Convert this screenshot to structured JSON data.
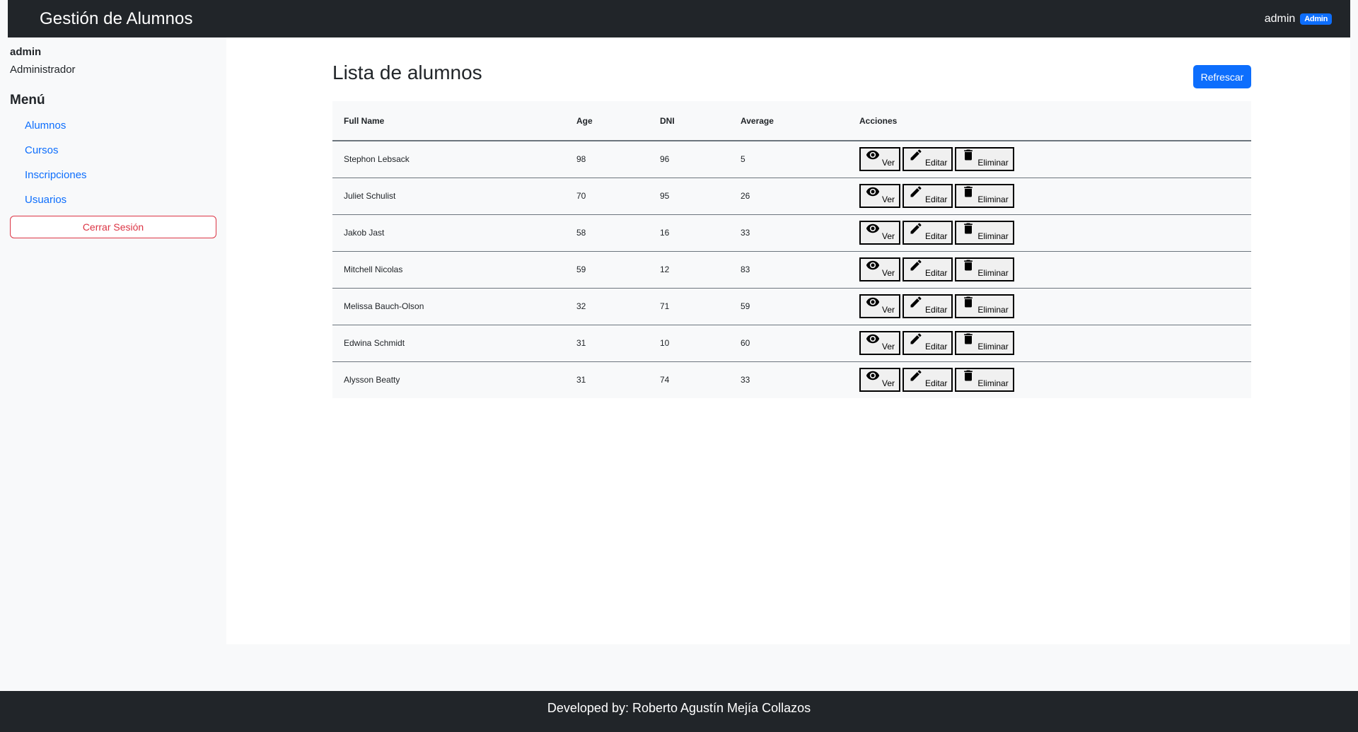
{
  "header": {
    "brand": "Gestión de Alumnos",
    "user": "admin",
    "role_badge": "Admin"
  },
  "sidebar": {
    "user": "admin",
    "role": "Administrador",
    "menu_title": "Menú",
    "items": [
      {
        "label": "Alumnos"
      },
      {
        "label": "Cursos"
      },
      {
        "label": "Inscripciones"
      },
      {
        "label": "Usuarios"
      }
    ],
    "logout_label": "Cerrar Sesión"
  },
  "main": {
    "title": "Lista de alumnos",
    "refresh_label": "Refrescar",
    "columns": [
      "Full Name",
      "Age",
      "DNI",
      "Average",
      "Acciones"
    ],
    "action_labels": {
      "view": "Ver",
      "edit": "Editar",
      "delete": "Eliminar"
    },
    "rows": [
      {
        "name": "Stephon Lebsack",
        "age": "98",
        "dni": "96",
        "average": "5"
      },
      {
        "name": "Juliet Schulist",
        "age": "70",
        "dni": "95",
        "average": "26"
      },
      {
        "name": "Jakob Jast",
        "age": "58",
        "dni": "16",
        "average": "33"
      },
      {
        "name": "Mitchell Nicolas",
        "age": "59",
        "dni": "12",
        "average": "83"
      },
      {
        "name": "Melissa Bauch-Olson",
        "age": "32",
        "dni": "71",
        "average": "59"
      },
      {
        "name": "Edwina Schmidt",
        "age": "31",
        "dni": "10",
        "average": "60"
      },
      {
        "name": "Alysson Beatty",
        "age": "31",
        "dni": "74",
        "average": "33"
      }
    ]
  },
  "footer": {
    "text": "Developed by: Roberto Agustín Mejía Collazos"
  },
  "colors": {
    "navbar": "#212529",
    "accent": "#0d6efd",
    "danger": "#dc3545"
  },
  "icons": {
    "view": "eye-icon",
    "edit": "pencil-icon",
    "delete": "trash-icon"
  }
}
